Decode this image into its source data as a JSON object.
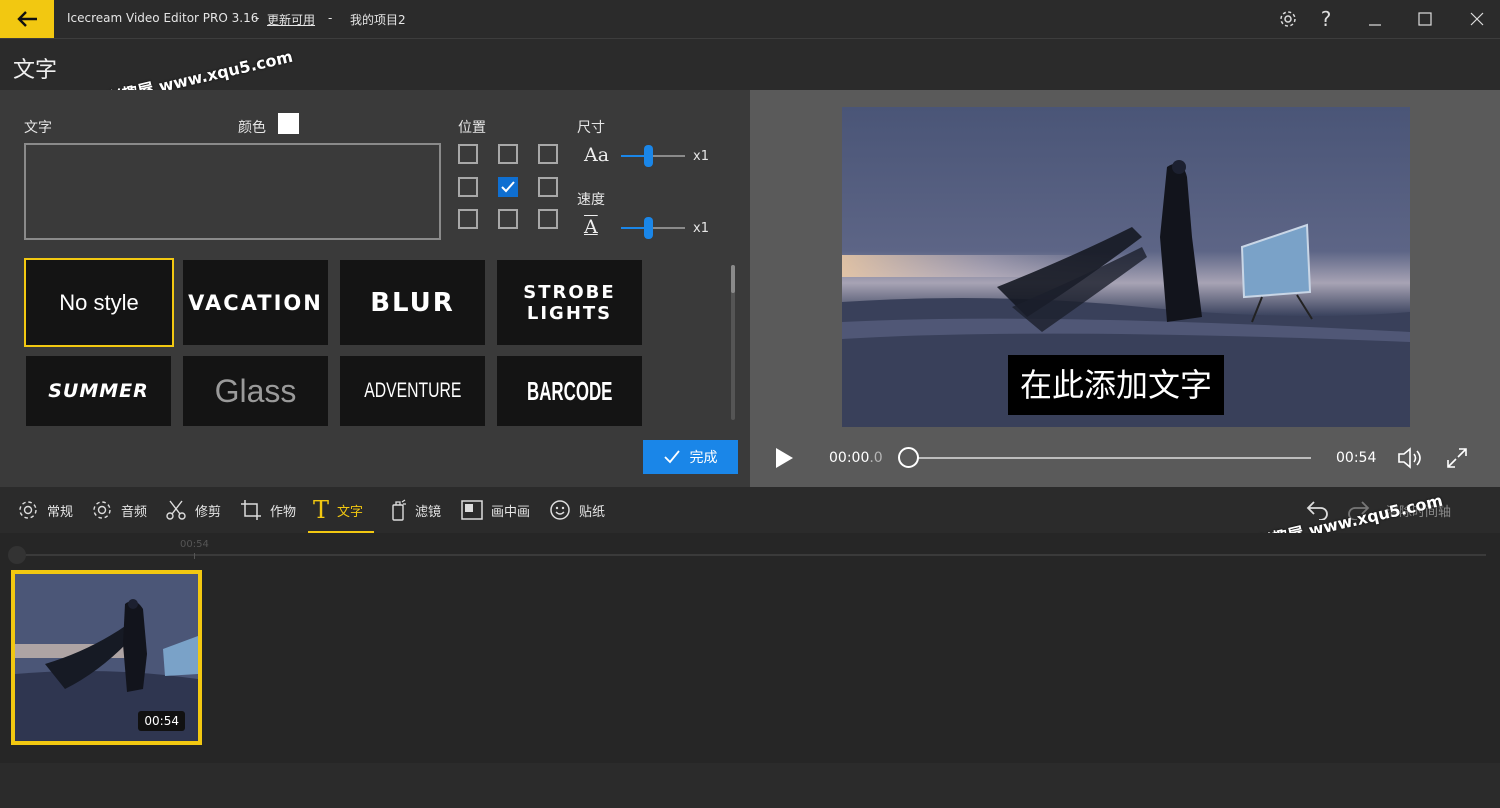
{
  "titlebar": {
    "app_name": "Icecream Video Editor PRO 3.16",
    "sep1": "-",
    "update_link": "更新可用",
    "sep2": "-",
    "project_name": "我的项目2"
  },
  "page": {
    "title": "文字"
  },
  "watermark": {
    "text": "兴趣屋 www.xqu5.com"
  },
  "editor": {
    "text_label": "文字",
    "color_label": "颜色",
    "color_value": "#ffffff",
    "position_label": "位置",
    "position_checked": [
      1,
      1
    ],
    "size_label": "尺寸",
    "size_icon_text": "Aa",
    "size_value": 0.42,
    "size_mult": "x1",
    "speed_label": "速度",
    "speed_icon_text": "A",
    "speed_value": 0.42,
    "speed_mult": "x1",
    "styles": [
      {
        "label": "No style",
        "selected": true
      },
      {
        "label": "VACATION",
        "selected": false
      },
      {
        "label": "BLUR",
        "selected": false
      },
      {
        "label": "STROBE LIGHTS",
        "selected": false
      },
      {
        "label": "SUMMER",
        "selected": false
      },
      {
        "label": "Glass",
        "selected": false
      },
      {
        "label": "ADVENTURE",
        "selected": false
      },
      {
        "label": "BARCODE",
        "selected": false
      }
    ],
    "done_label": "完成"
  },
  "preview": {
    "overlay_text": "在此添加文字",
    "current_time_main": "00:00",
    "current_time_frac": ".0",
    "progress": 0.0,
    "duration": "00:54"
  },
  "toolbar": {
    "items": [
      {
        "label": "常规",
        "icon": "gear-icon"
      },
      {
        "label": "音频",
        "icon": "audio-gear-icon"
      },
      {
        "label": "修剪",
        "icon": "scissors-icon"
      },
      {
        "label": "作物",
        "icon": "crop-icon"
      },
      {
        "label": "文字",
        "icon": "text-icon",
        "active": true
      },
      {
        "label": "滤镜",
        "icon": "filter-icon"
      },
      {
        "label": "画中画",
        "icon": "pip-icon"
      },
      {
        "label": "贴纸",
        "icon": "sticker-icon"
      }
    ],
    "clear_timeline": "清除时间轴"
  },
  "timeline": {
    "ruler_label": "00:54",
    "clip_duration": "00:54"
  },
  "colors": {
    "accent": "#f2c811",
    "blue": "#1a86e8"
  }
}
